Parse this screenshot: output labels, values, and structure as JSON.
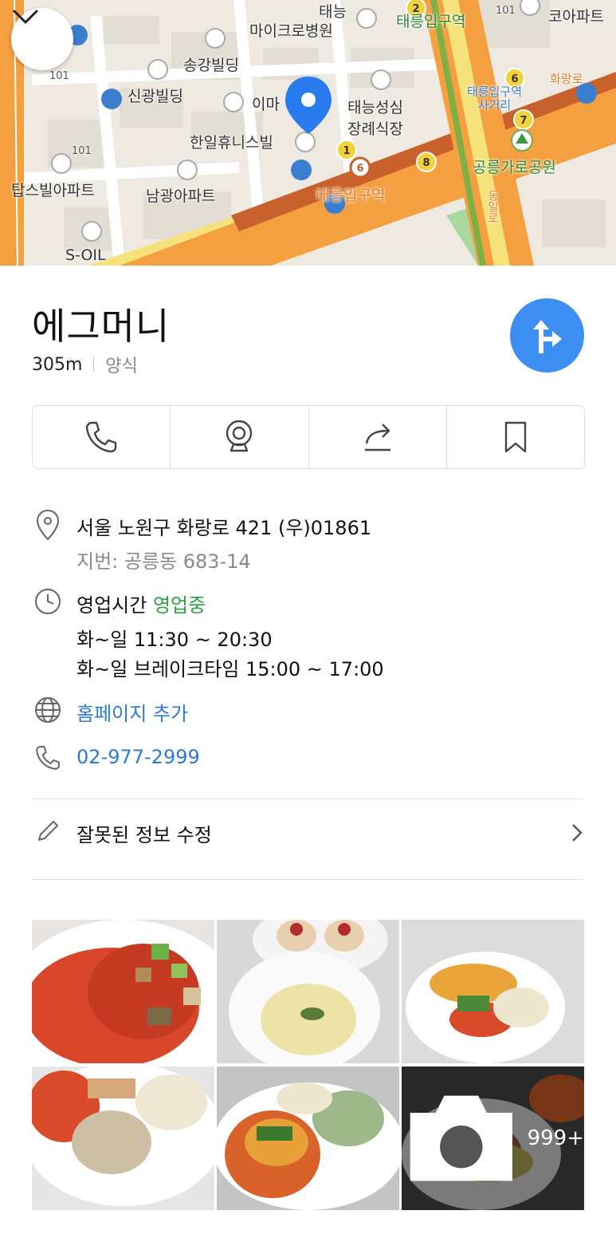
{
  "map": {
    "labels": {
      "taeneung": "태능",
      "micro_hospital": "마이크로병원",
      "taereung_station_top": "태릉입구역",
      "co_apt": "코아파트",
      "song_building": "송강빌딩",
      "shinkwang": "신광빌딩",
      "emart": "이마",
      "taeneung_funeral": "태능성심\n장례식장",
      "taereung_cross": "태릉입구역\n사거리",
      "hwarang_ro": "화랑로",
      "hanil": "한일휴니스빌",
      "gongneung_park": "공릉가로공원",
      "tops_apt": "탑스빌아파트",
      "namgwang_apt": "남광아파트",
      "taereung_station_bottom": "태릉입구역",
      "soil": "S-OIL",
      "num_101_a": "101",
      "num_101_b": "101",
      "num_101_c": "101",
      "vertical_road": "동일로"
    },
    "line_badges": [
      "1",
      "6",
      "8",
      "6",
      "7",
      "2"
    ],
    "colors": {
      "road_orange": "#f5a040",
      "road_yellow": "#f6e27a",
      "line6": "#c8612b",
      "pin": "#2b7bf0"
    }
  },
  "place": {
    "name": "에그머니",
    "distance": "305m",
    "category": "양식"
  },
  "actions": {
    "call": "call",
    "street_view": "street-view",
    "share": "share",
    "save": "save"
  },
  "address": {
    "road": "서울 노원구 화랑로 421 (우)01861",
    "lot": "지번: 공릉동 683-14"
  },
  "hours": {
    "label": "영업시간",
    "status": "영업중",
    "line1": "화~일 11:30 ~ 20:30",
    "line2": "화~일 브레이크타임 15:00 ~ 17:00"
  },
  "homepage": {
    "label": "홈페이지 추가"
  },
  "phone": {
    "number": "02-977-2999"
  },
  "edit": {
    "label": "잘못된 정보 수정"
  },
  "photos": {
    "more_count": "999+"
  },
  "colors": {
    "accent": "#3d8ef2",
    "link": "#2b7bd6",
    "open": "#2ea044"
  }
}
